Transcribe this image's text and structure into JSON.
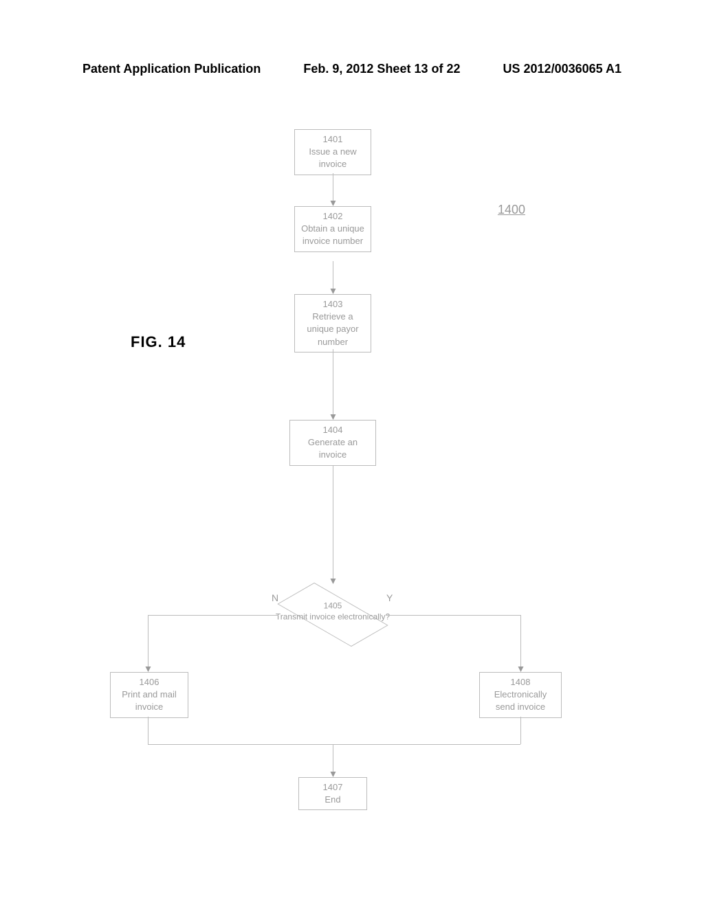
{
  "header": {
    "left": "Patent Application Publication",
    "center": "Feb. 9, 2012  Sheet 13 of 22",
    "right": "US 2012/0036065 A1"
  },
  "figure_label": "FIG. 14",
  "ref_number": "1400",
  "boxes": {
    "b1401": {
      "num": "1401",
      "text": "Issue a new invoice"
    },
    "b1402": {
      "num": "1402",
      "text": "Obtain a unique invoice number"
    },
    "b1403": {
      "num": "1403",
      "text": "Retrieve a unique payor number"
    },
    "b1404": {
      "num": "1404",
      "text": "Generate an invoice"
    },
    "b1405": {
      "num": "1405",
      "text": "Transmit invoice electronically?"
    },
    "b1406": {
      "num": "1406",
      "text": "Print and mail invoice"
    },
    "b1407": {
      "num": "1407",
      "text": "End"
    },
    "b1408": {
      "num": "1408",
      "text": "Electronically send invoice"
    }
  },
  "branches": {
    "no": "N",
    "yes": "Y"
  }
}
